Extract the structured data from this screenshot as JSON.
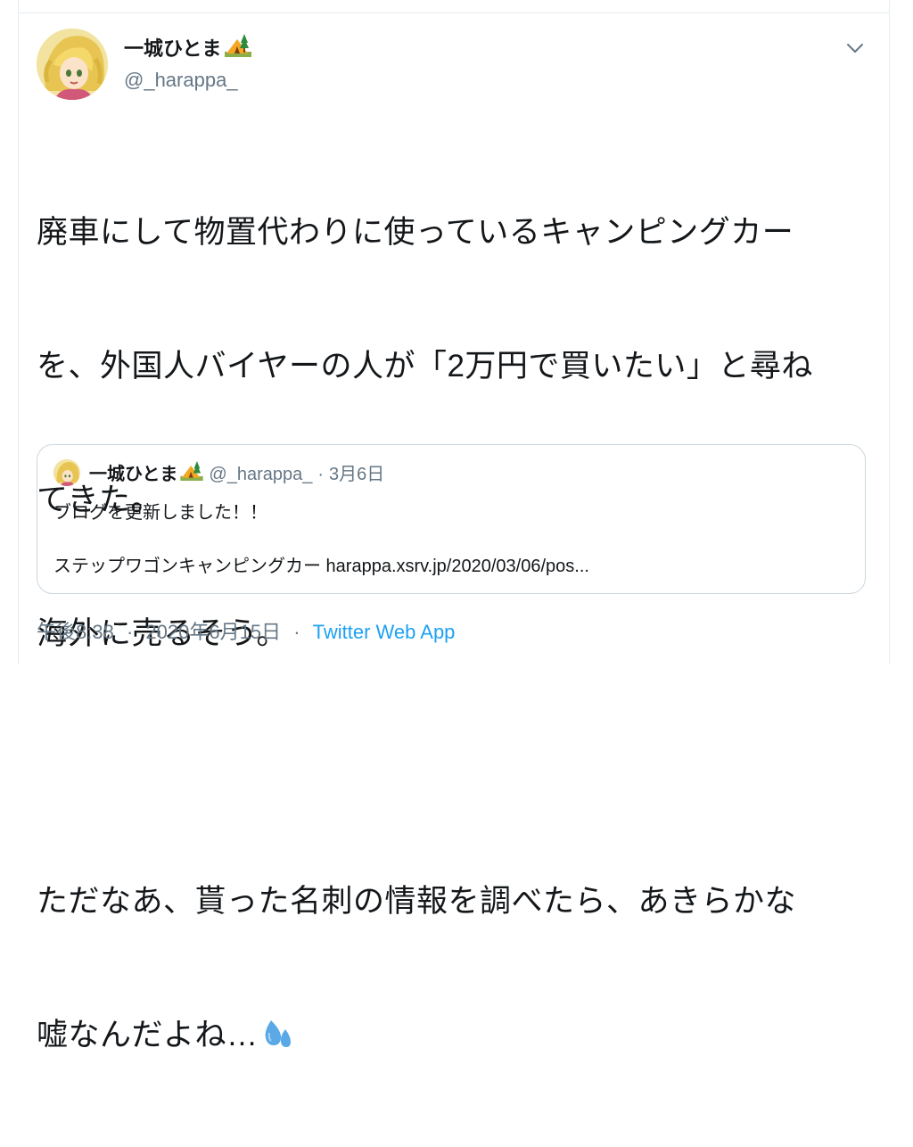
{
  "author": {
    "display_name": "一城ひとま",
    "handle": "@_harappa_",
    "badge_icon": "camping-tent-emoji-icon"
  },
  "tweet": {
    "lines": [
      "廃車にして物置代わりに使っているキャンピングカー",
      "を、外国人バイヤーの人が「2万円で買いたい」と尋ね",
      "てきた。",
      "海外に売るそう。",
      "",
      "ただなあ、貰った名刺の情報を調べたら、あきらかな",
      "嘘なんだよね…"
    ],
    "trailing_emoji": "sweat-droplets-emoji-icon"
  },
  "quoted_tweet": {
    "display_name": "一城ひとま",
    "handle": "@_harappa_",
    "separator": "·",
    "date": "3月6日",
    "line1": "ブログを更新しました！！",
    "line2": "ステップワゴンキャンピングカー harappa.xsrv.jp/2020/03/06/pos..."
  },
  "meta": {
    "time": "午後8:38",
    "separator": "·",
    "date": "2020年6月15日",
    "source": "Twitter Web App"
  },
  "colors": {
    "text": "#14171a",
    "secondary": "#657786",
    "link": "#1da1f2",
    "border": "#ccd6dd"
  }
}
